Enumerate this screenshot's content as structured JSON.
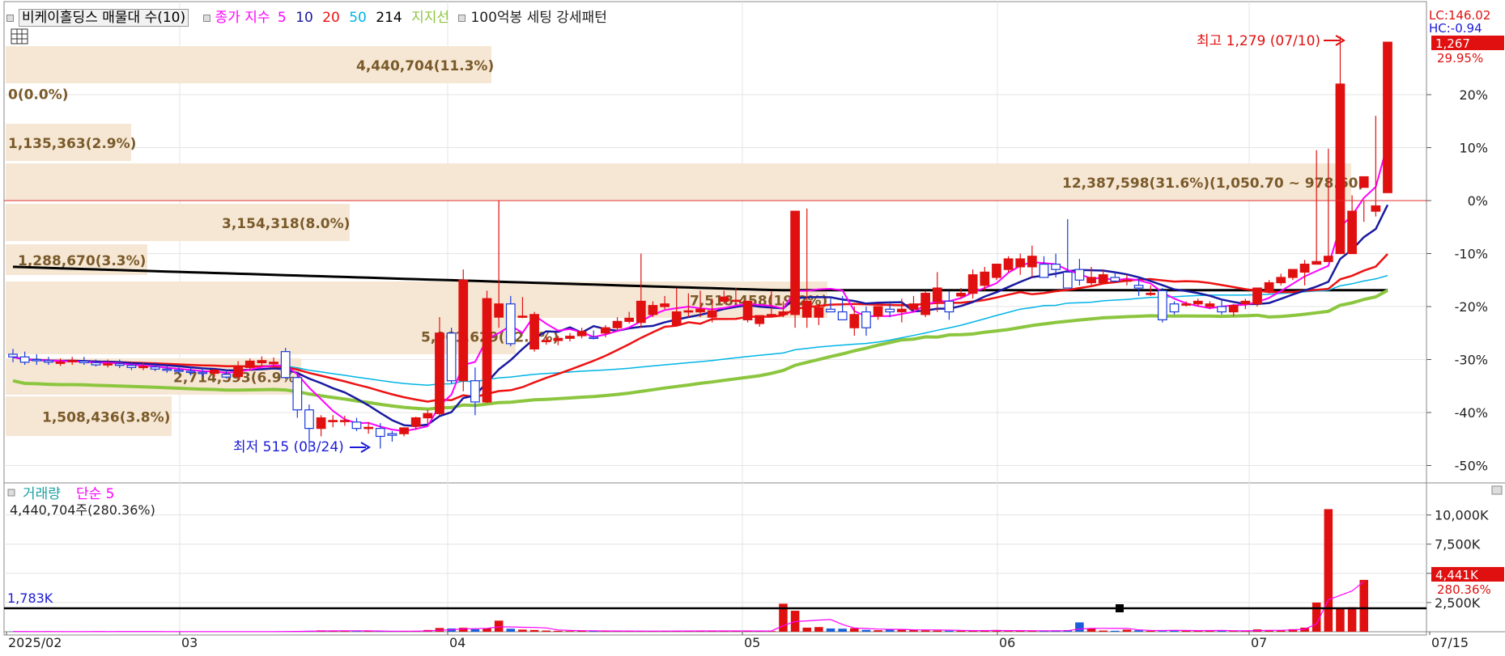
{
  "indicator_bar": {
    "stock_label": "비케이홀딩스 매물대 수(10)",
    "close_index_label": "종가 지수",
    "ma_periods": [
      "5",
      "10",
      "20",
      "50",
      "214"
    ],
    "support_label": "지지선",
    "pattern_label": "100억봉 세팅 강세패턴",
    "ma_colors": [
      "#ff00ff",
      "#1a1aa0",
      "#ee1111",
      "#00b4e6",
      "#000000"
    ],
    "support_color": "#8cc63f"
  },
  "top_right": {
    "lc": "LC:146.02",
    "hc": "HC:-0.94"
  },
  "price_badges": {
    "last": "1,267",
    "last_pct": "29.95%"
  },
  "annotations": {
    "high": "최고 1,279 (07/10)",
    "low": "최저 515 (03/24)",
    "volume_ref": "1,783K"
  },
  "volume_panel": {
    "title": "거래량",
    "ma_label": "단순 5",
    "summary": "4,440,704주(280.36%)",
    "last_badge": "4,441K",
    "last_pct": "280.36%"
  },
  "volume_profile": [
    {
      "label": "4,440,704(11.3%)"
    },
    {
      "label": "0(0.0%)"
    },
    {
      "label": "1,135,363(2.9%)"
    },
    {
      "label": "12,387,598(31.6%)(1,050.70 ~ 978.60)"
    },
    {
      "label": "3,154,318(8.0%)"
    },
    {
      "label": "1,288,670(3.3%)"
    },
    {
      "label": "7,518,458(19.2%)"
    },
    {
      "label": "5,061,629(12.9%)"
    },
    {
      "label": "2,714,593(6.9%)"
    },
    {
      "label": "1,508,436(3.8%)"
    }
  ],
  "chart_data": {
    "type": "candlestick",
    "y_axis_ticks": [
      "20%",
      "10%",
      "0%",
      "-10%",
      "-20%",
      "-30%",
      "-40%",
      "-50%"
    ],
    "y_axis_values": [
      20,
      10,
      0,
      -10,
      -20,
      -30,
      -40,
      -50
    ],
    "ylim": [
      -53,
      27
    ],
    "x_axis_labels": [
      "2025/02",
      "03",
      "04",
      "05",
      "06",
      "07",
      "07/15"
    ],
    "volume_axis_ticks": [
      "10,000K",
      "7,500K",
      "5,000K",
      "2,500K"
    ],
    "volume_axis_values": [
      10000,
      7500,
      5000,
      2500
    ],
    "volume_ylim": [
      0,
      11500
    ],
    "candles_pct": [
      [
        -29,
        -28,
        -30.5,
        -29.5
      ],
      [
        -29.5,
        -28.5,
        -31,
        -30.5
      ],
      [
        -30,
        -29,
        -31,
        -30.2
      ],
      [
        -30.2,
        -29.5,
        -31,
        -30.5
      ],
      [
        -30.5,
        -29.8,
        -31.2,
        -30.5
      ],
      [
        -30.3,
        -29.5,
        -31,
        -30.2
      ],
      [
        -30.3,
        -29.5,
        -31,
        -30.6
      ],
      [
        -30.6,
        -30,
        -31.3,
        -31
      ],
      [
        -30.8,
        -30,
        -31.5,
        -30.8
      ],
      [
        -30.8,
        -30,
        -31.6,
        -31.1
      ],
      [
        -31.1,
        -30.5,
        -32,
        -31.5
      ],
      [
        -31.4,
        -30.6,
        -32,
        -31.3
      ],
      [
        -31.4,
        -30.5,
        -32.2,
        -31.8
      ],
      [
        -31.8,
        -31,
        -32.5,
        -32
      ],
      [
        -32,
        -31.2,
        -32.7,
        -32.2
      ],
      [
        -32.2,
        -31.4,
        -33,
        -32.4
      ],
      [
        -32.4,
        -31.6,
        -33.2,
        -32.6
      ],
      [
        -32.6,
        -31.8,
        -33.2,
        -32
      ],
      [
        -32.8,
        -32,
        -33.6,
        -33.3
      ],
      [
        -33.2,
        -30.3,
        -33.8,
        -31.3
      ],
      [
        -31.5,
        -29.8,
        -32,
        -30.3
      ],
      [
        -30.6,
        -29.4,
        -31.2,
        -30.2
      ],
      [
        -30.8,
        -29.6,
        -31.3,
        -30.5
      ],
      [
        -28.5,
        -27.8,
        -33.7,
        -33.4
      ],
      [
        -33.4,
        -32.5,
        -41,
        -39.5
      ],
      [
        -39.5,
        -38.5,
        -47.5,
        -43
      ],
      [
        -43,
        -40.5,
        -44.5,
        -41
      ],
      [
        -41.5,
        -40.5,
        -42.8,
        -41.5
      ],
      [
        -41.5,
        -40.6,
        -42.5,
        -41.5
      ],
      [
        -41.8,
        -41,
        -43.5,
        -43
      ],
      [
        -43,
        -41.8,
        -44,
        -42.8
      ],
      [
        -43,
        -42,
        -46.8,
        -44.5
      ],
      [
        -44,
        -43.5,
        -45.5,
        -44.3
      ],
      [
        -44,
        -42.8,
        -44.5,
        -42.9
      ],
      [
        -42.6,
        -40.8,
        -43.3,
        -41
      ],
      [
        -41,
        -39.5,
        -42,
        -40.2
      ],
      [
        -40.2,
        -22,
        -40.5,
        -25
      ],
      [
        -25,
        -24,
        -34.5,
        -34
      ],
      [
        -34,
        -13,
        -36,
        -15
      ],
      [
        -34,
        -31.5,
        -40.5,
        -38
      ],
      [
        -38,
        -17,
        -38.2,
        -18.5
      ],
      [
        -22,
        0,
        -24,
        -19.5
      ],
      [
        -19.5,
        -18,
        -27.5,
        -27
      ],
      [
        -21.8,
        -18.2,
        -22.2,
        -21.8
      ],
      [
        -28,
        -21,
        -28.5,
        -21.5
      ],
      [
        -26.5,
        -25.5,
        -27.2,
        -26.4
      ],
      [
        -26.4,
        -25.5,
        -27.3,
        -26
      ],
      [
        -26,
        -25,
        -26.6,
        -25.6
      ],
      [
        -25.5,
        -24,
        -26,
        -24.7
      ],
      [
        -25.8,
        -24.5,
        -26.2,
        -26
      ],
      [
        -25,
        -23.5,
        -25.8,
        -24
      ],
      [
        -24,
        -22,
        -24.5,
        -22.8
      ],
      [
        -22.8,
        -21,
        -23.2,
        -22.2
      ],
      [
        -23,
        -10,
        -24,
        -19
      ],
      [
        -21.5,
        -19,
        -22,
        -19.8
      ],
      [
        -20,
        -18,
        -20.5,
        -19.5
      ],
      [
        -23.5,
        -16.5,
        -23.8,
        -21
      ],
      [
        -21,
        -17.5,
        -22,
        -20.8
      ],
      [
        -21,
        -17,
        -22,
        -20.5
      ],
      [
        -22,
        -18.5,
        -23,
        -20.8
      ],
      [
        -19,
        -17,
        -19.5,
        -18.2
      ],
      [
        -19,
        -16.5,
        -19.5,
        -18.8
      ],
      [
        -22.5,
        -19,
        -23,
        -19
      ],
      [
        -23.2,
        -21.7,
        -23.8,
        -21.7
      ],
      [
        -21.7,
        -17,
        -22,
        -21.5
      ],
      [
        -21.5,
        -19,
        -22,
        -21
      ],
      [
        -21.5,
        -15.5,
        -24,
        -2
      ],
      [
        -22,
        -1.5,
        -24,
        -19
      ],
      [
        -22,
        -19.5,
        -23.5,
        -20.2
      ],
      [
        -20.5,
        -18.5,
        -21,
        -21
      ],
      [
        -21,
        -18,
        -22,
        -22.5
      ],
      [
        -24,
        -20,
        -25.5,
        -21.5
      ],
      [
        -21,
        -20,
        -25.5,
        -24
      ],
      [
        -21.8,
        -20,
        -22.5,
        -20
      ],
      [
        -20.5,
        -19,
        -22,
        -21
      ],
      [
        -21,
        -18.5,
        -23,
        -20.5
      ],
      [
        -20.5,
        -18,
        -21,
        -19.5
      ],
      [
        -21.5,
        -17,
        -22,
        -17.5
      ],
      [
        -19,
        -13.5,
        -21,
        -16.5
      ],
      [
        -19,
        -17,
        -22.5,
        -21
      ],
      [
        -18,
        -16.5,
        -18.5,
        -17.5
      ],
      [
        -17.5,
        -13,
        -18.5,
        -14
      ],
      [
        -16,
        -12.5,
        -17,
        -13.5
      ],
      [
        -14.5,
        -12,
        -15,
        -12
      ],
      [
        -13,
        -10.5,
        -13.5,
        -11
      ],
      [
        -12.5,
        -10,
        -14,
        -11
      ],
      [
        -12.5,
        -8.5,
        -14.5,
        -10.5
      ],
      [
        -12,
        -10.5,
        -14.5,
        -14.5
      ],
      [
        -12,
        -10,
        -14.5,
        -13
      ],
      [
        -13.5,
        -3.5,
        -14.5,
        -16.5
      ],
      [
        -13,
        -11,
        -16,
        -15
      ],
      [
        -15.5,
        -12.5,
        -16,
        -14.5
      ],
      [
        -15.5,
        -13,
        -15.5,
        -14
      ],
      [
        -14.5,
        -13.5,
        -15.5,
        -15.2
      ],
      [
        -15,
        -14,
        -16,
        -15
      ],
      [
        -16,
        -14.5,
        -18,
        -16.5
      ],
      [
        -17.5,
        -16,
        -18,
        -17.5
      ],
      [
        -17,
        -16.5,
        -23,
        -22.5
      ],
      [
        -19.5,
        -19,
        -21.5,
        -21
      ],
      [
        -19.5,
        -19,
        -20,
        -19.5
      ],
      [
        -19.5,
        -18.5,
        -20,
        -19
      ],
      [
        -20,
        -19,
        -20.5,
        -19.5
      ],
      [
        -20,
        -18.5,
        -21.5,
        -21
      ],
      [
        -21,
        -19.5,
        -21.8,
        -19.8
      ],
      [
        -19.5,
        -18.5,
        -20.5,
        -19
      ],
      [
        -19.5,
        -16.5,
        -20,
        -16.5
      ],
      [
        -17,
        -15,
        -17.5,
        -15.5
      ],
      [
        -15.5,
        -13.8,
        -16,
        -14.5
      ],
      [
        -14.5,
        -13,
        -15,
        -13
      ],
      [
        -13.5,
        -11.2,
        -16,
        -12
      ],
      [
        -12,
        9.5,
        -12,
        -11.5
      ],
      [
        -11.5,
        9.8,
        -11.5,
        -10.5
      ],
      [
        -10,
        31,
        -6.5,
        22
      ],
      [
        -10,
        1,
        -2,
        -2
      ],
      [
        2.5,
        0,
        -4,
        4.5
      ],
      [
        -2,
        16,
        -3,
        -1
      ],
      [
        1.5,
        30,
        2,
        29.9
      ]
    ],
    "volumes_k": [
      20,
      15,
      12,
      25,
      10,
      18,
      14,
      22,
      12,
      30,
      15,
      12,
      18,
      10,
      14,
      20,
      12,
      15,
      10,
      25,
      12,
      15,
      10,
      30,
      60,
      80,
      120,
      90,
      60,
      55,
      70,
      40,
      30,
      35,
      80,
      150,
      320,
      280,
      340,
      220,
      300,
      950,
      260,
      180,
      150,
      100,
      80,
      60,
      70,
      90,
      55,
      40,
      60,
      45,
      60,
      70,
      75,
      65,
      85,
      60,
      55,
      70,
      65,
      50,
      55,
      2400,
      1800,
      350,
      400,
      280,
      260,
      300,
      160,
      130,
      180,
      220,
      150,
      120,
      100,
      90,
      80,
      110,
      90,
      150,
      60,
      70,
      65,
      65,
      120,
      140,
      800,
      300,
      100,
      80,
      180,
      130,
      70,
      60,
      150,
      130,
      90,
      90,
      80,
      60,
      70,
      200,
      150,
      140,
      220,
      350,
      2500,
      10500,
      2000,
      2100,
      4441
    ],
    "ma_colors_note": "MA5 magenta, MA10 navy, MA20 red, MA50 cyan, MA214 black, support green"
  }
}
